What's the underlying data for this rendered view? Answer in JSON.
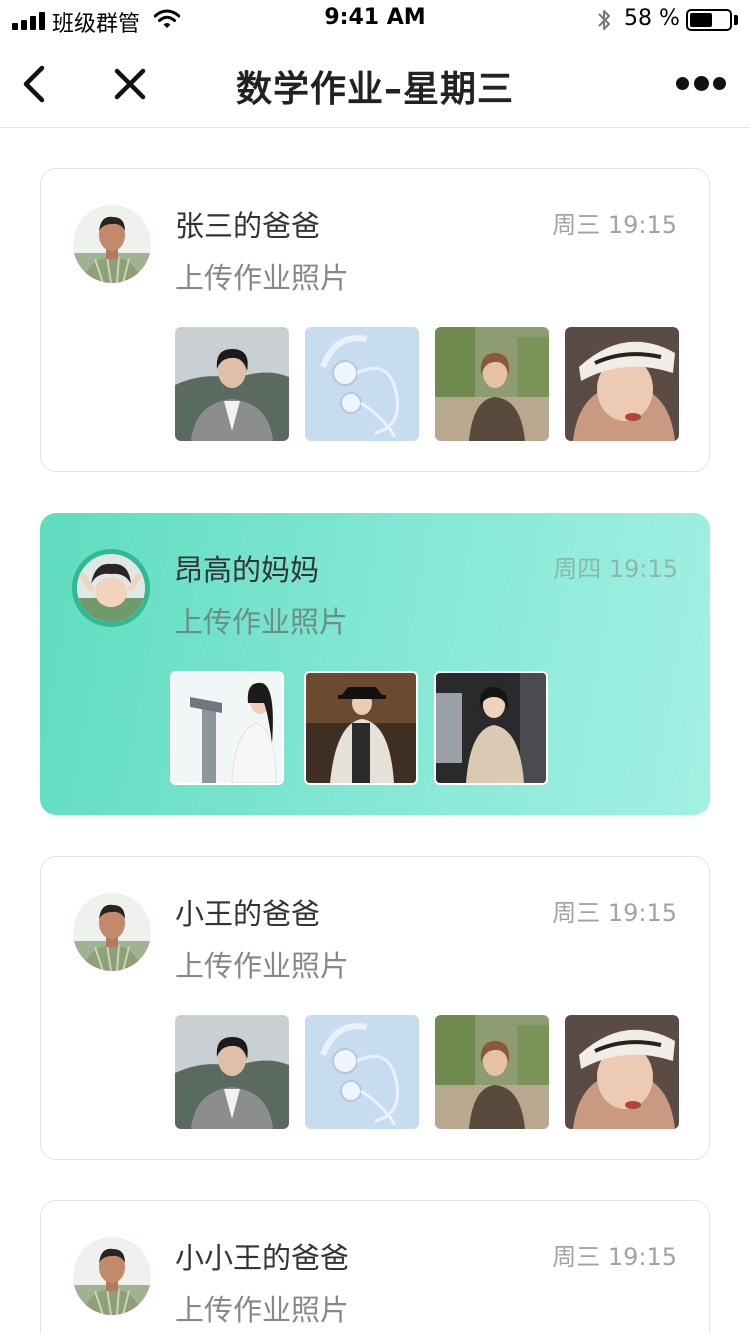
{
  "status_bar": {
    "carrier": "班级群管",
    "time": "9:41 AM",
    "battery_percent": "58 %",
    "battery_level": 0.58
  },
  "nav": {
    "title": "数学作业–星期三",
    "back_icon": "chevron-left-icon",
    "close_icon": "close-icon",
    "more_icon": "more-dots-icon"
  },
  "colors": {
    "active_card_start": "#5fdcc0",
    "active_card_end": "#a3f0e3",
    "avatar_ring": "#33b896",
    "time_text": "#a3a3a3"
  },
  "submissions": [
    {
      "name": "张三的爸爸",
      "time": "周三 19:15",
      "desc": "上传作业照片",
      "avatar": "man-portrait",
      "photos": [
        "man-in-suit",
        "headphones",
        "woman-sitting",
        "woman-cap"
      ]
    },
    {
      "name": "昂高的妈妈",
      "time": "周四 19:15",
      "desc": "上传作业照片",
      "avatar": "child-portrait",
      "selected": true,
      "photos": [
        "woman-with-suitcase",
        "woman-in-coat",
        "woman-street"
      ]
    },
    {
      "name": "小王的爸爸",
      "time": "周三 19:15",
      "desc": "上传作业照片",
      "avatar": "man-portrait",
      "photos": [
        "man-in-suit",
        "headphones",
        "woman-sitting",
        "woman-cap"
      ]
    },
    {
      "name": "小小王的爸爸",
      "time": "周三 19:15",
      "desc": "上传作业照片",
      "avatar": "man-portrait",
      "photos": []
    }
  ]
}
